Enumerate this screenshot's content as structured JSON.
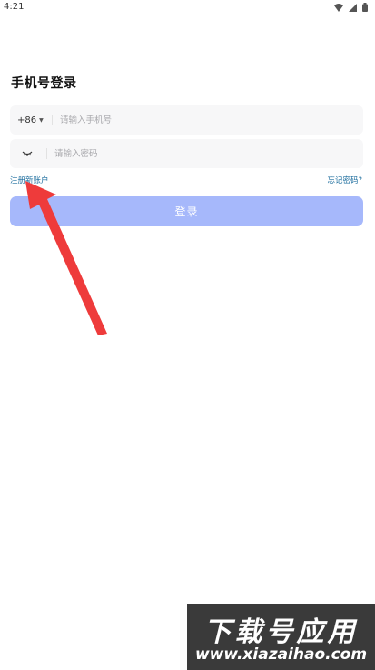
{
  "status_bar": {
    "time": "4:21"
  },
  "login": {
    "title": "手机号登录",
    "country_code": "+86",
    "phone_placeholder": "请输入手机号",
    "password_placeholder": "请输入密码",
    "register_label": "注册新账户",
    "forgot_label": "忘记密码?",
    "submit_label": "登录"
  },
  "colors": {
    "button": "#a6b8fb",
    "link": "#1f6f9f",
    "input_bg": "#f7f7f8",
    "arrow": "#ee3b3b"
  },
  "icons": [
    "wifi-icon",
    "signal-icon",
    "battery-icon",
    "eye-closed-icon",
    "caret-down-icon"
  ],
  "watermark": {
    "title": "下载号应用",
    "url": "www.xiazaihao.com"
  }
}
